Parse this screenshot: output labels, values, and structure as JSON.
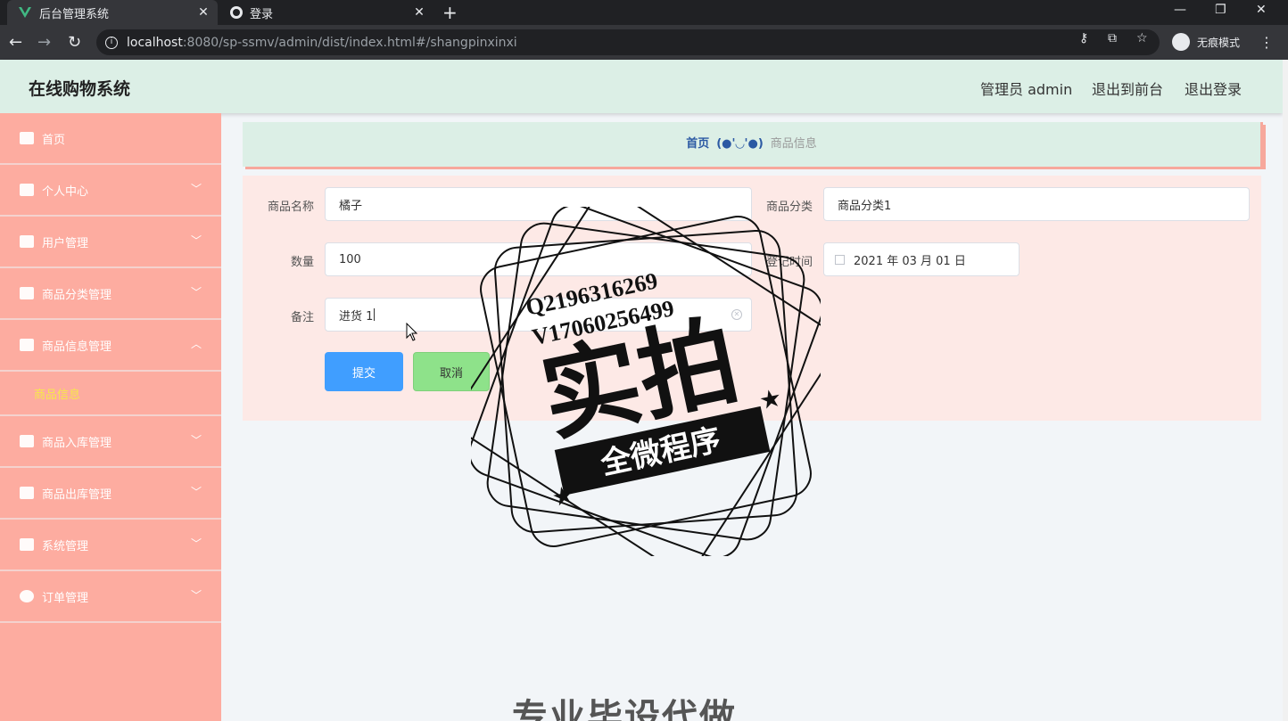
{
  "browser": {
    "tabs": [
      {
        "title": "后台管理系统",
        "active": true,
        "icon": "vue-icon"
      },
      {
        "title": "登录",
        "active": false,
        "icon": "globe-icon"
      }
    ],
    "url_host": "localhost",
    "url_rest": ":8080/sp-ssmv/admin/dist/index.html#/shangpinxinxi",
    "incognito_label": "无痕模式"
  },
  "header": {
    "title": "在线购物系统",
    "user": "管理员 admin",
    "to_front": "退出到前台",
    "logout": "退出登录"
  },
  "sidebar": {
    "items": [
      {
        "label": "首页",
        "icon": "home-icon",
        "expandable": false
      },
      {
        "label": "个人中心",
        "icon": "user-icon",
        "expandable": true
      },
      {
        "label": "用户管理",
        "icon": "send-icon",
        "expandable": true
      },
      {
        "label": "商品分类管理",
        "icon": "grid-icon",
        "expandable": true
      },
      {
        "label": "商品信息管理",
        "icon": "document-icon",
        "expandable": true,
        "open": true
      },
      {
        "label": "商品入库管理",
        "icon": "ticket-icon",
        "expandable": true
      },
      {
        "label": "商品出库管理",
        "icon": "person-icon",
        "expandable": true
      },
      {
        "label": "系统管理",
        "icon": "flag-icon",
        "expandable": true
      },
      {
        "label": "订单管理",
        "icon": "gauge-icon",
        "expandable": true
      }
    ],
    "submenu_active": "商品信息"
  },
  "breadcrumb": {
    "home": "首页",
    "separator": "(●'◡'●)",
    "current": "商品信息"
  },
  "form": {
    "name_label": "商品名称",
    "name_value": "橘子",
    "category_label": "商品分类",
    "category_value": "商品分类1",
    "quantity_label": "数量",
    "quantity_value": "100",
    "date_label": "登记时间",
    "date_value": "2021 年 03 月 01 日",
    "remark_label": "备注",
    "remark_value": "进货 1",
    "submit": "提交",
    "cancel": "取消"
  },
  "watermark": {
    "line1": "Q2196316269",
    "line2": "V17060256499",
    "main": "实拍",
    "banner": "全微程序",
    "bottom": "专业毕设代做"
  }
}
